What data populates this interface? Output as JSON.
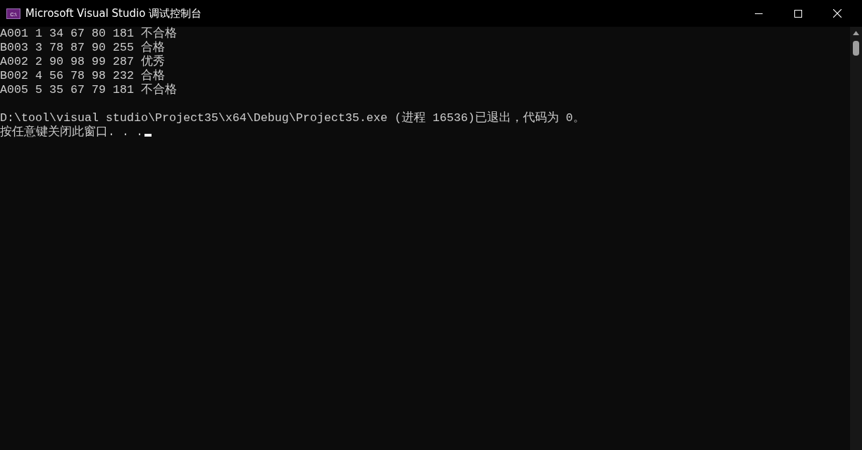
{
  "window": {
    "title": "Microsoft Visual Studio 调试控制台",
    "icon_text": "C:\\"
  },
  "console": {
    "output": [
      "A001 1 34 67 80 181 不合格",
      "B003 3 78 87 90 255 合格",
      "A002 2 90 98 99 287 优秀",
      "B002 4 56 78 98 232 合格",
      "A005 5 35 67 79 181 不合格"
    ],
    "footer": [
      "D:\\tool\\visual studio\\Project35\\x64\\Debug\\Project35.exe (进程 16536)已退出，代码为 0。",
      "按任意键关闭此窗口. . ."
    ]
  }
}
